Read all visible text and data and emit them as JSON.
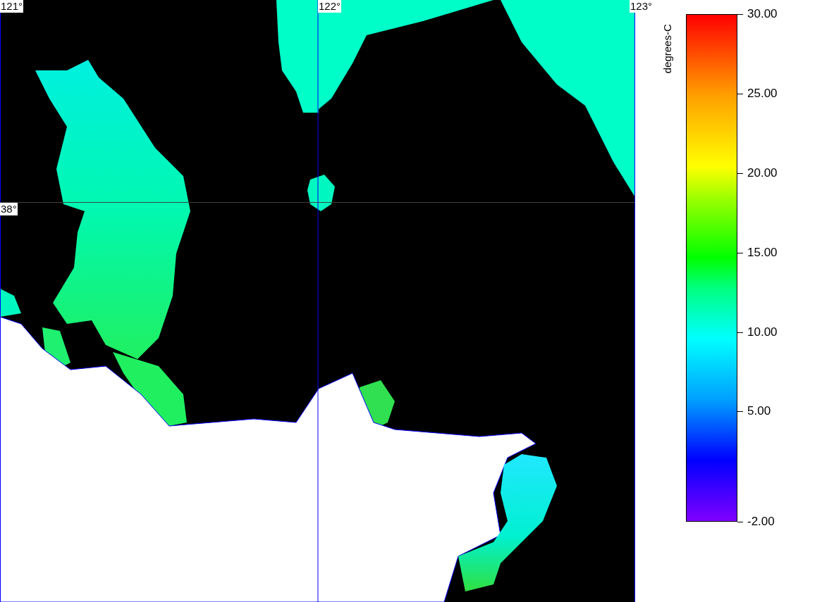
{
  "map": {
    "grid_labels": [
      {
        "text": "121°"
      },
      {
        "text": "122°"
      },
      {
        "text": "123°"
      },
      {
        "text": "38°"
      }
    ]
  },
  "colorbar": {
    "title": "degrees-C",
    "labels": [
      "30.00",
      "25.00",
      "20.00",
      "15.00",
      "10.00",
      "5.00",
      "-2.00"
    ]
  }
}
